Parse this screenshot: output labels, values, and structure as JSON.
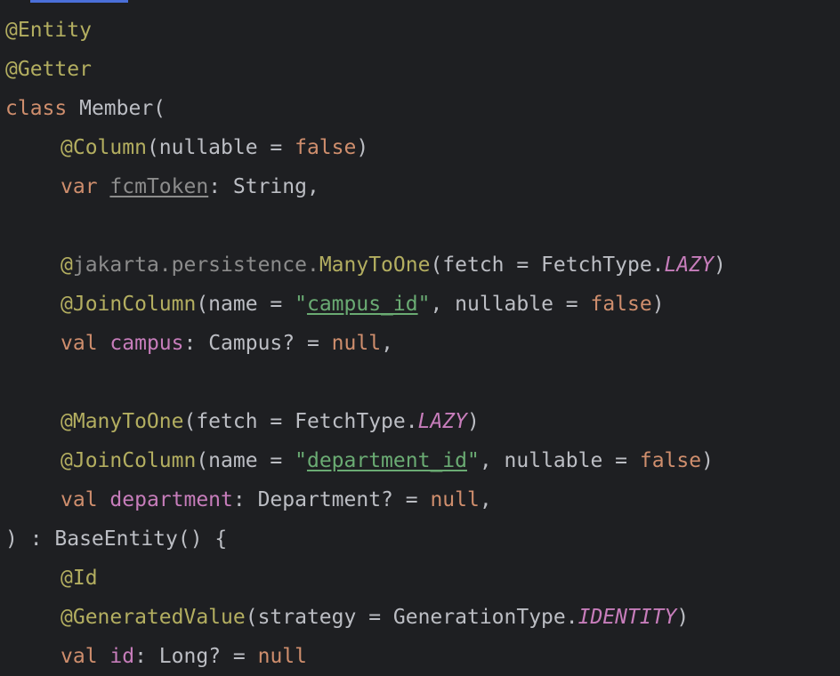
{
  "lines": [
    [
      "@Entity"
    ],
    [
      "@Getter"
    ],
    [
      "class",
      " Member("
    ],
    [
      "@Column",
      "(nullable = ",
      "false",
      ")"
    ],
    [
      "var",
      " ",
      "fcmToken",
      ": String,"
    ],
    [],
    [
      "@",
      "jakarta.persistence.",
      "ManyToOne",
      "(fetch = FetchType.",
      "LAZY",
      ")"
    ],
    [
      "@JoinColumn",
      "(name = ",
      "\"",
      "campus_id",
      "\"",
      ", nullable = ",
      "false",
      ")"
    ],
    [
      "val",
      " ",
      "campus",
      ": Campus? = ",
      "null",
      ","
    ],
    [],
    [
      "@ManyToOne",
      "(fetch = FetchType.",
      "LAZY",
      ")"
    ],
    [
      "@JoinColumn",
      "(name = ",
      "\"",
      "department_id",
      "\"",
      ", nullable = ",
      "false",
      ")"
    ],
    [
      "val",
      " ",
      "department",
      ": Department? = ",
      "null",
      ","
    ],
    [
      ") : BaseEntity() {"
    ],
    [
      "@Id"
    ],
    [
      "@GeneratedValue",
      "(strategy = GenerationType.",
      "IDENTITY",
      ")"
    ],
    [
      "val",
      " ",
      "id",
      ": Long? = ",
      "null"
    ]
  ]
}
